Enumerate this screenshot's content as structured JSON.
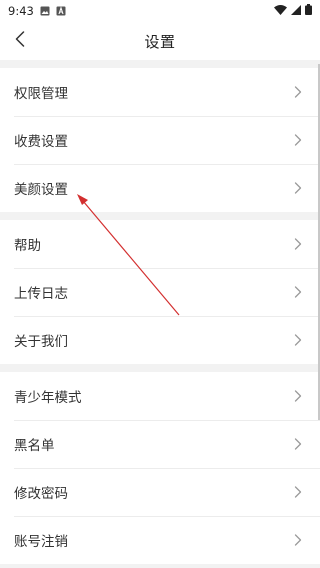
{
  "status_bar": {
    "time": "9:43",
    "left_icons": [
      "image-icon",
      "a-notification-icon"
    ],
    "right_icons": [
      "wifi-icon",
      "signal-icon",
      "battery-icon"
    ]
  },
  "header": {
    "title": "设置",
    "back_icon": "chevron-left-icon"
  },
  "groups": [
    {
      "items": [
        "权限管理",
        "收费设置",
        "美颜设置"
      ]
    },
    {
      "items": [
        "帮助",
        "上传日志",
        "关于我们"
      ]
    },
    {
      "items": [
        "青少年模式",
        "黑名单",
        "修改密码",
        "账号注销"
      ]
    }
  ],
  "colors": {
    "background": "#f2f2f2",
    "surface": "#ffffff",
    "divider": "#ececec",
    "text": "#333333",
    "chevron": "#9a9a9a",
    "annotation_arrow": "#d32f2f"
  }
}
